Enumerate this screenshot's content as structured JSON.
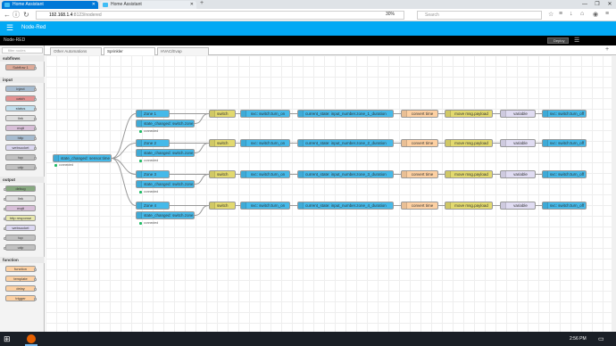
{
  "browser": {
    "tabs": [
      {
        "label": "Home Assistant",
        "active": true
      },
      {
        "label": "Home Assistant",
        "active": false
      }
    ],
    "new_tab": "+",
    "window_controls": [
      "—",
      "❐",
      "✕"
    ],
    "url_host": "192.168.1.4",
    "url_rest": ":8123/nodered",
    "zoom": "30%",
    "search_placeholder": "Search"
  },
  "ha": {
    "title": "Node-Red",
    "menu_icon": "☰"
  },
  "nodered": {
    "logo": "Node-RED",
    "deploy": "Deploy",
    "menu_icon": "☰",
    "filter_placeholder": "filter nodes",
    "tabs": [
      "Other Automations",
      "Sprinkler",
      "HVAC/Evap"
    ],
    "active_tab": 1
  },
  "palette": {
    "categories": [
      {
        "name": "subflows",
        "nodes": [
          "Subflow 1"
        ]
      },
      {
        "name": "input",
        "nodes": [
          "inject",
          "catch",
          "status",
          "link",
          "mqtt",
          "http",
          "websocket",
          "tcp",
          "udp"
        ]
      },
      {
        "name": "output",
        "nodes": [
          "debug",
          "link",
          "mqtt",
          "http response",
          "websocket",
          "tcp",
          "udp"
        ]
      },
      {
        "name": "function",
        "nodes": [
          "function",
          "template",
          "delay",
          "trigger"
        ]
      }
    ]
  },
  "flow": {
    "trigger": {
      "label": "state_changed: sensor.time",
      "status": "connected"
    },
    "zones": [
      {
        "inject": "Zone 1",
        "state": "state_changed: switch.zone_1",
        "status": "connected",
        "switch": "switch",
        "turn_on": "svc: switch:turn_on",
        "current": "current_state: input_number.zone_1_duration",
        "convert": "convert time",
        "payload": "move msg.payload",
        "variable": "variable",
        "turn_off": "svc: switch:turn_off"
      },
      {
        "inject": "Zone 2",
        "state": "state_changed: switch.zone_2",
        "status": "connected",
        "switch": "switch",
        "turn_on": "svc: switch:turn_on",
        "current": "current_state: input_number.zone_2_duration",
        "convert": "convert time",
        "payload": "move msg.payload",
        "variable": "variable",
        "turn_off": "svc: switch:turn_off"
      },
      {
        "inject": "Zone 3",
        "state": "state_changed: switch.zone_3",
        "status": "connected",
        "switch": "switch",
        "turn_on": "svc: switch:turn_on",
        "current": "current_state: input_number.zone_3_duration",
        "convert": "convert time",
        "payload": "move msg.payload",
        "variable": "variable",
        "turn_off": "svc: switch:turn_off"
      },
      {
        "inject": "Zone 4",
        "state": "state_changed: switch.zone_4",
        "status": "connected",
        "switch": "switch",
        "turn_on": "svc: switch:turn_on",
        "current": "current_state: input_number.zone_4_duration",
        "convert": "convert time",
        "payload": "move msg.payload",
        "variable": "variable",
        "turn_off": "svc: switch:turn_off"
      }
    ]
  },
  "taskbar": {
    "start_icon": "⊞",
    "clock": "2:56 PM",
    "notif_icon": "▭"
  },
  "colors": {
    "ha_blue": "#03a9f4",
    "node_blue": "#45b9e9",
    "switch_yellow": "#e2d96e",
    "function_orange": "#fdd0a2"
  }
}
